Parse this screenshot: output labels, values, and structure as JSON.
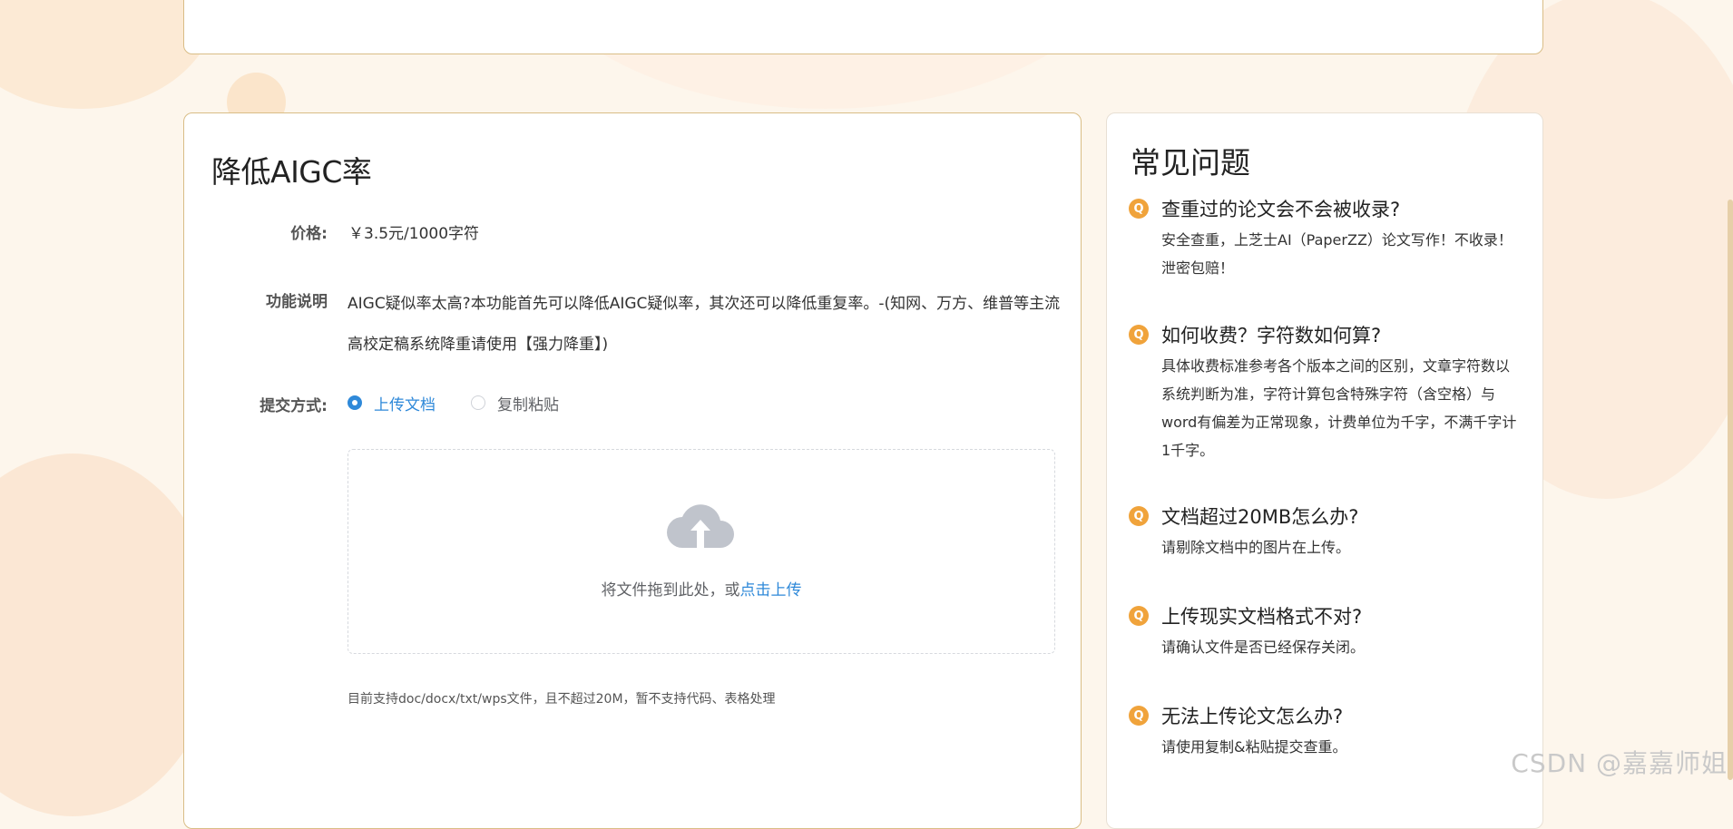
{
  "form": {
    "title": "降低AIGC率",
    "price_label": "价格:",
    "price_value": "￥3.5元/1000字符",
    "desc_label": "功能说明",
    "desc_text": "AIGC疑似率太高?本功能首先可以降低AIGC疑似率，其次还可以降低重复率。-(知网、万方、维普等主流高校定稿系统降重请使用【强力降重】)",
    "method_label": "提交方式:",
    "method_options": [
      {
        "label": "上传文档",
        "selected": true
      },
      {
        "label": "复制粘贴",
        "selected": false
      }
    ],
    "upload_hint_prefix": "将文件拖到此处，或",
    "upload_link": "点击上传",
    "support_note": "目前支持doc/docx/txt/wps文件，且不超过20M，暂不支持代码、表格处理"
  },
  "faq": {
    "title": "常见问题",
    "icon_letter": "Q",
    "items": [
      {
        "q": "查重过的论文会不会被收录?",
        "a": "安全查重，上芝士AI（PaperZZ）论文写作！不收录！泄密包赔！"
      },
      {
        "q": "如何收费？字符数如何算?",
        "a": "具体收费标准参考各个版本之间的区别，文章字符数以系统判断为准，字符计算包含特殊字符（含空格）与word有偏差为正常现象，计费单位为千字，不满千字计1千字。"
      },
      {
        "q": "文档超过20MB怎么办?",
        "a": "请剔除文档中的图片在上传。"
      },
      {
        "q": "上传现实文档格式不对?",
        "a": "请确认文件是否已经保存关闭。"
      },
      {
        "q": "无法上传论文怎么办?",
        "a": "请使用复制&粘贴提交查重。"
      }
    ]
  },
  "watermark": "CSDN @嘉嘉师姐",
  "colors": {
    "accent": "#2f89d9",
    "faq_icon": "#f0a33b",
    "card_border": "#d9bd86",
    "background": "#fdf6ec"
  },
  "icons": {
    "upload": "cloud-upload-icon",
    "faq": "faq-question-icon"
  }
}
